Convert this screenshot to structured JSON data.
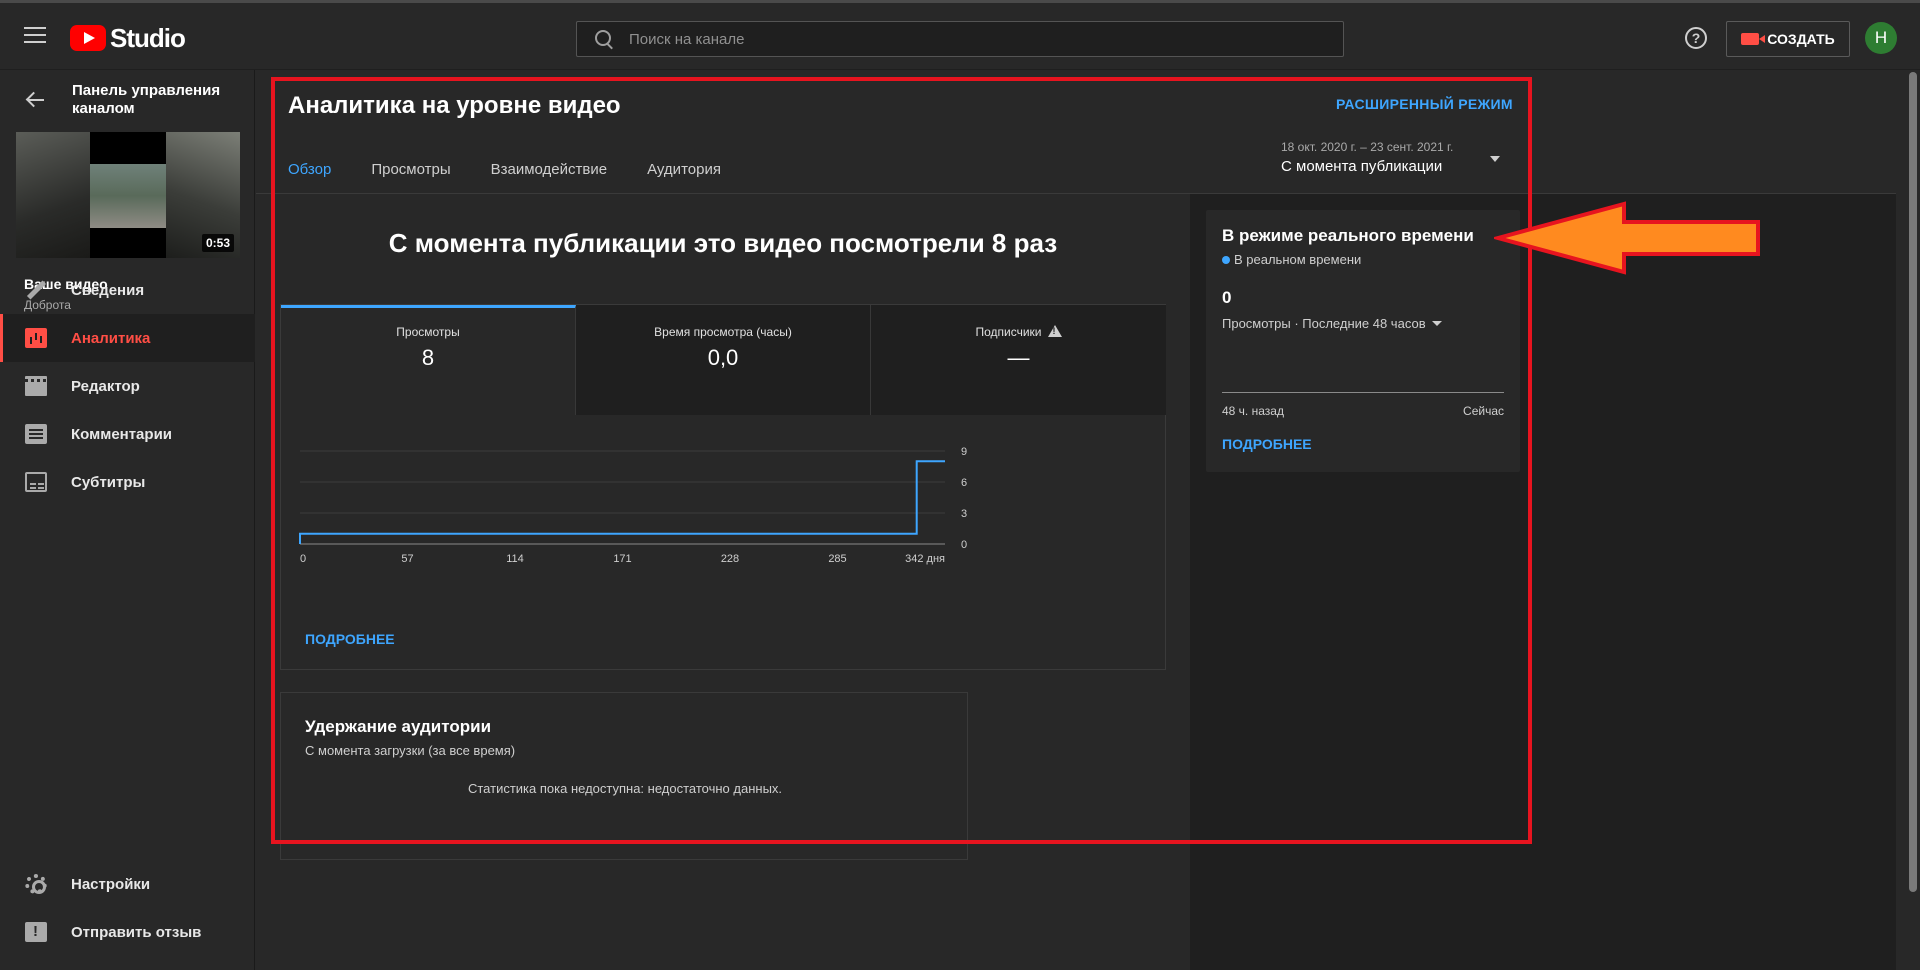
{
  "header": {
    "logo_text": "Studio",
    "search_placeholder": "Поиск на канале",
    "help_label": "?",
    "create_label": "СОЗДАТЬ",
    "avatar_letter": "Н"
  },
  "sidebar": {
    "back_label": "Панель управления каналом",
    "video_duration": "0:53",
    "your_video_label": "Ваше видео",
    "channel_name": "Доброта",
    "items": [
      {
        "label": "Сведения",
        "icon": "pencil-icon"
      },
      {
        "label": "Аналитика",
        "icon": "analytics-icon",
        "active": true
      },
      {
        "label": "Редактор",
        "icon": "film-icon"
      },
      {
        "label": "Комментарии",
        "icon": "comment-icon"
      },
      {
        "label": "Субтитры",
        "icon": "subtitles-icon"
      }
    ],
    "bottom_items": [
      {
        "label": "Настройки",
        "icon": "gear-icon"
      },
      {
        "label": "Отправить отзыв",
        "icon": "feedback-icon"
      }
    ]
  },
  "main": {
    "title": "Аналитика на уровне видео",
    "advanced_mode": "РАСШИРЕННЫЙ РЕЖИМ",
    "tabs": [
      {
        "label": "Обзор",
        "active": true
      },
      {
        "label": "Просмотры"
      },
      {
        "label": "Взаимодействие"
      },
      {
        "label": "Аудитория"
      }
    ],
    "date_range": "18 окт. 2020 г. – 23 сент. 2021 г.",
    "date_selection": "С момента публикации",
    "headline": "С момента публикации это видео посмотрели 8 раз",
    "metrics": [
      {
        "label": "Просмотры",
        "value": "8"
      },
      {
        "label": "Время просмотра (часы)",
        "value": "0,0"
      },
      {
        "label": "Подписчики",
        "value": "—"
      }
    ],
    "chart_more": "ПОДРОБНЕЕ",
    "retention": {
      "title": "Удержание аудитории",
      "subtitle": "С момента загрузки (за все время)",
      "empty_message": "Статистика пока недоступна: недостаточно данных."
    }
  },
  "realtime": {
    "title": "В режиме реального времени",
    "live_label": "В реальном времени",
    "count": "0",
    "period": "Просмотры · Последние 48 часов",
    "axis_left": "48 ч. назад",
    "axis_right": "Сейчас",
    "more": "ПОДРОБНЕЕ"
  },
  "colors": {
    "accent_blue": "#3ea6ff",
    "active_red": "#ff4e45",
    "annotation_red": "#e7141f",
    "annotation_orange": "#ff8a1f"
  },
  "chart_data": {
    "type": "line",
    "x": [
      0,
      342
    ],
    "series": [
      {
        "values": [
          {
            "x": 0,
            "y": 0
          },
          {
            "x": 0,
            "y": 1
          },
          {
            "x": 327,
            "y": 1
          },
          {
            "x": 327,
            "y": 8
          },
          {
            "x": 342,
            "y": 8
          }
        ]
      }
    ],
    "x_ticks": [
      0,
      57,
      114,
      171,
      228,
      285,
      342
    ],
    "x_tick_labels": [
      "0",
      "57",
      "114",
      "171",
      "228",
      "285",
      "342 дня"
    ],
    "y_ticks": [
      0,
      3,
      6,
      9
    ],
    "y_tick_labels": [
      "0",
      "3",
      "6",
      "9"
    ],
    "xlim": [
      0,
      342
    ],
    "ylim": [
      0,
      9
    ],
    "grid": true,
    "color": "#3ea6ff"
  }
}
